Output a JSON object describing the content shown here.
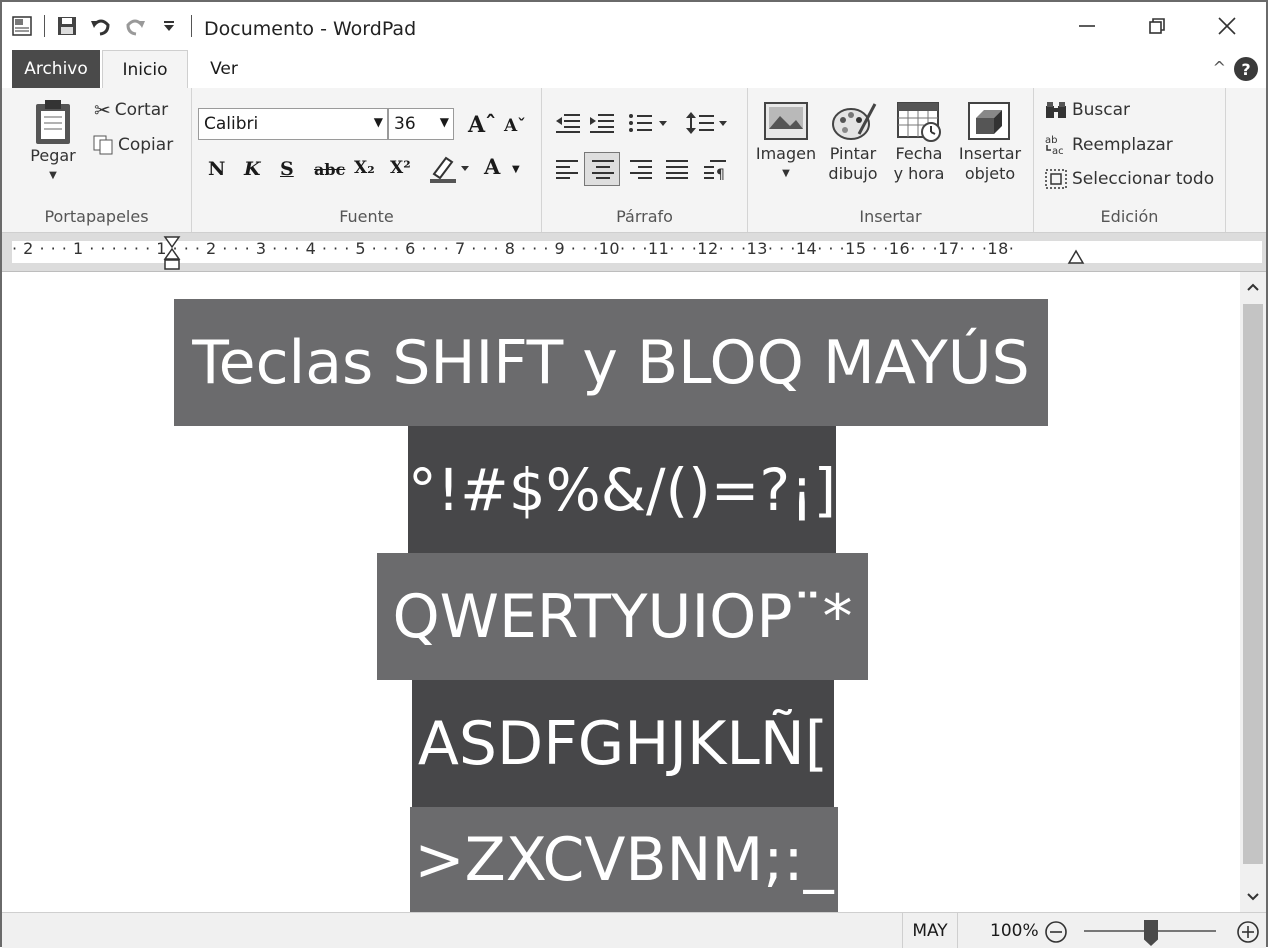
{
  "window": {
    "title": "Documento - WordPad"
  },
  "tabs": {
    "archivo": "Archivo",
    "inicio": "Inicio",
    "ver": "Ver"
  },
  "ribbon": {
    "portapapeles": {
      "label": "Portapapeles",
      "pegar": "Pegar",
      "cortar": "Cortar",
      "copiar": "Copiar"
    },
    "fuente": {
      "label": "Fuente",
      "font_name": "Calibri",
      "font_size": "36",
      "bold": "N",
      "italic": "K",
      "underline": "S",
      "strike": "abc",
      "subscript": "X₂",
      "superscript": "X²",
      "color_letter": "A"
    },
    "parrafo": {
      "label": "Párrafo"
    },
    "insertar": {
      "label": "Insertar",
      "imagen": "Imagen",
      "pintar_1": "Pintar",
      "pintar_2": "dibujo",
      "fecha_1": "Fecha",
      "fecha_2": "y hora",
      "objeto_1": "Insertar",
      "objeto_2": "objeto"
    },
    "edicion": {
      "label": "Edición",
      "buscar": "Buscar",
      "reemplazar": "Reemplazar",
      "seleccionar": "Seleccionar todo"
    }
  },
  "ruler": {
    "text": "· 2 · · · 1 · · ·   · · · 1 · · · 2 · · · 3 · · · 4 · · · 5 · · · 6 · · · 7 · · · 8 · · · 9 · · ·10· · ·11· · ·12· · ·13· · ·14· · ·15  · ·16· · ·17· · ·18·"
  },
  "document": {
    "lines": [
      "Teclas SHIFT y BLOQ MAYÚS",
      "°!#$%&/()=?¡]",
      "QWERTYUIOP¨*",
      "ASDFGHJKLÑ[",
      ">ZXCVBNM;:_"
    ]
  },
  "status": {
    "caps": "MAY",
    "zoom": "100%"
  },
  "colors": {
    "block_light": "#6b6b6d",
    "block_dark": "#474749",
    "archivo_tab": "#4a4a4a"
  }
}
